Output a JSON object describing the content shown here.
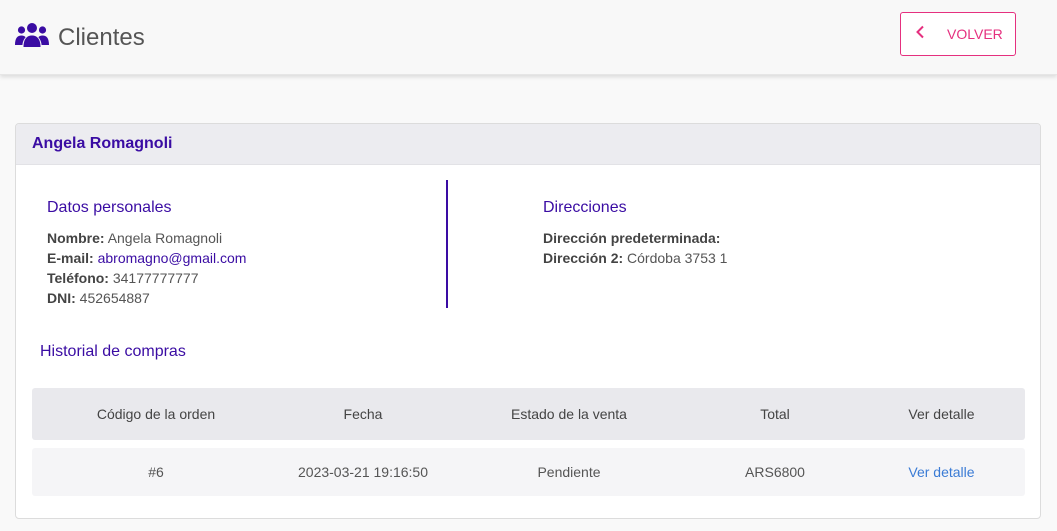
{
  "header": {
    "title": "Clientes",
    "icon": "users-icon",
    "back_label": "VOLVER",
    "accent_color": "#e5307f",
    "brand_color": "#3a0ca3"
  },
  "client": {
    "name": "Angela Romagnoli"
  },
  "personal": {
    "section_title": "Datos personales",
    "name_label": "Nombre:",
    "name_value": "Angela Romagnoli",
    "email_label": "E-mail:",
    "email_value": "abromagno@gmail.com",
    "phone_label": "Teléfono:",
    "phone_value": "34177777777",
    "dni_label": "DNI:",
    "dni_value": "452654887"
  },
  "addresses": {
    "section_title": "Direcciones",
    "default_label": "Dirección predeterminada:",
    "default_value": "",
    "address2_label": "Dirección 2:",
    "address2_value": "Córdoba 3753 1"
  },
  "history": {
    "section_title": "Historial de compras",
    "columns": [
      "Código de la orden",
      "Fecha",
      "Estado de la venta",
      "Total",
      "Ver detalle"
    ],
    "rows": [
      {
        "order": "#6",
        "date": "2023-03-21 19:16:50",
        "status": "Pendiente",
        "total": "ARS6800",
        "detail": "Ver detalle"
      }
    ]
  }
}
